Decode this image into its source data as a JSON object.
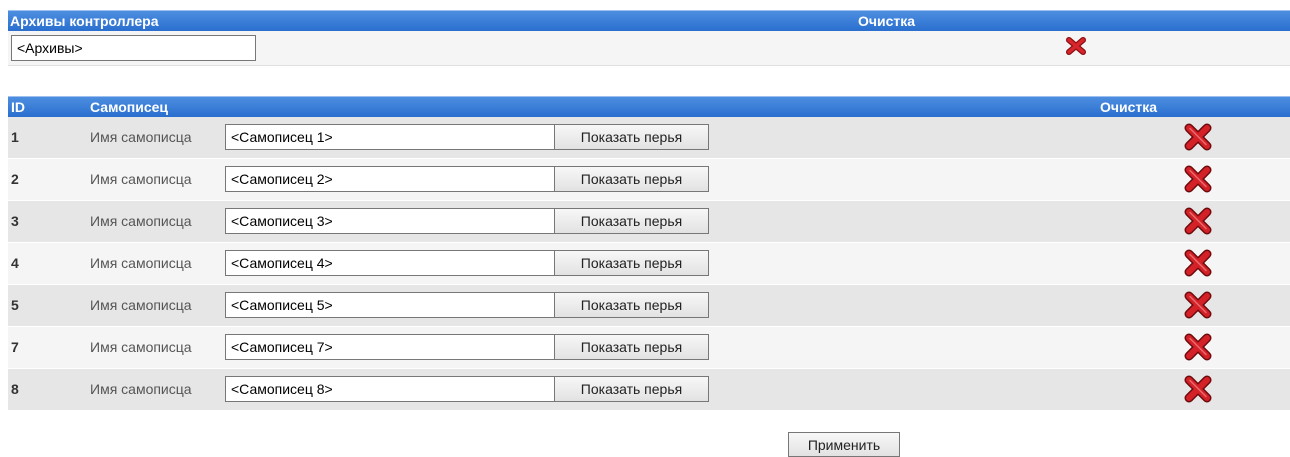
{
  "archives": {
    "header_title": "Архивы контроллера",
    "header_clear": "Очистка",
    "value": "<Архивы>",
    "clear_icon": "red-x-icon"
  },
  "recorders": {
    "header_id": "ID",
    "header_name": "Самописец",
    "header_clear": "Очистка",
    "name_label": "Имя самописца",
    "show_pens_label": "Показать перья",
    "delete_icon": "red-x-icon",
    "rows": [
      {
        "id": "1",
        "name": "<Самописец 1>"
      },
      {
        "id": "2",
        "name": "<Самописец 2>"
      },
      {
        "id": "3",
        "name": "<Самописец 3>"
      },
      {
        "id": "4",
        "name": "<Самописец 4>"
      },
      {
        "id": "5",
        "name": "<Самописец 5>"
      },
      {
        "id": "7",
        "name": "<Самописец 7>"
      },
      {
        "id": "8",
        "name": "<Самописец 8>"
      }
    ]
  },
  "apply_label": "Применить",
  "colors": {
    "header_bg": "#2a6fcf",
    "delete_red": "#c8141b",
    "row_odd": "#e6e6e6",
    "row_even": "#f5f5f5"
  }
}
